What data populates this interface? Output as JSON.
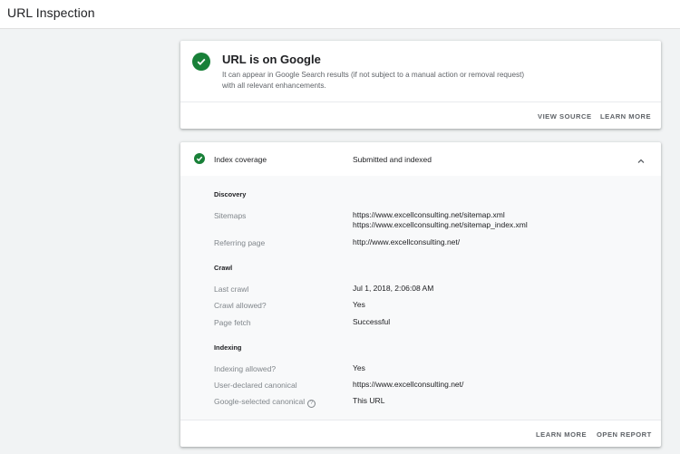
{
  "header": {
    "title": "URL Inspection"
  },
  "summary": {
    "title": "URL is on Google",
    "description": "It can appear in Google Search results (if not subject to a manual action or removal request) with all relevant enhancements.",
    "actions": {
      "view_source": "VIEW SOURCE",
      "learn_more": "LEARN MORE"
    }
  },
  "coverage": {
    "label": "Index coverage",
    "status": "Submitted and indexed",
    "sections": {
      "discovery": {
        "heading": "Discovery",
        "sitemaps_key": "Sitemaps",
        "sitemaps_values": [
          "https://www.excellconsulting.net/sitemap.xml",
          "https://www.excellconsulting.net/sitemap_index.xml"
        ],
        "referring_key": "Referring page",
        "referring_value": "http://www.excellconsulting.net/"
      },
      "crawl": {
        "heading": "Crawl",
        "last_crawl_key": "Last crawl",
        "last_crawl_value": "Jul 1, 2018, 2:06:08 AM",
        "crawl_allowed_key": "Crawl allowed?",
        "crawl_allowed_value": "Yes",
        "page_fetch_key": "Page fetch",
        "page_fetch_value": "Successful"
      },
      "indexing": {
        "heading": "Indexing",
        "indexing_allowed_key": "Indexing allowed?",
        "indexing_allowed_value": "Yes",
        "user_canonical_key": "User-declared canonical",
        "user_canonical_value": "https://www.excellconsulting.net/",
        "google_canonical_key": "Google-selected canonical",
        "google_canonical_help": "?",
        "google_canonical_value": "This URL"
      }
    },
    "actions": {
      "learn_more": "LEARN MORE",
      "open_report": "OPEN REPORT"
    }
  },
  "icons": {
    "status": "check-circle-icon",
    "collapse": "chevron-up-icon",
    "help": "help-icon"
  },
  "colors": {
    "success": "#188038",
    "background": "#f1f3f4"
  }
}
